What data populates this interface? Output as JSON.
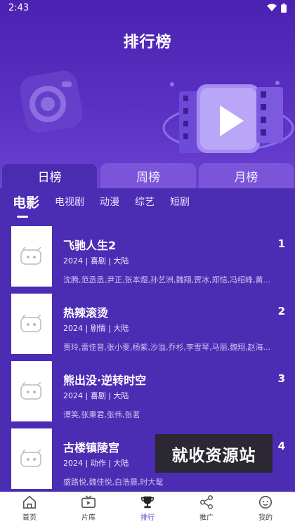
{
  "status": {
    "time": "2:43"
  },
  "page_title": "排行榜",
  "main_tabs": [
    {
      "label": "日榜",
      "active": true
    },
    {
      "label": "周榜",
      "active": false
    },
    {
      "label": "月榜",
      "active": false
    }
  ],
  "category_tabs": [
    {
      "label": "电影",
      "active": true
    },
    {
      "label": "电视剧",
      "active": false
    },
    {
      "label": "动漫",
      "active": false
    },
    {
      "label": "综艺",
      "active": false
    },
    {
      "label": "短剧",
      "active": false
    }
  ],
  "items": [
    {
      "title": "飞驰人生2",
      "meta": "2024 | 喜剧 | 大陆",
      "cast": "沈腾,范丞丞,尹正,张本煜,孙艺洲,魏翔,贾冰,郑恺,冯绍峰,黄...",
      "rank": "1"
    },
    {
      "title": "热辣滚烫",
      "meta": "2024 | 剧情 | 大陆",
      "cast": "贾玲,雷佳音,张小斐,杨紫,沙溢,乔杉,李雪琴,马丽,魏翔,赵海...",
      "rank": "2"
    },
    {
      "title": "熊出没·逆转时空",
      "meta": "2024 | 喜剧 | 大陆",
      "cast": "谭笑,张秉君,张伟,张茗",
      "rank": "3"
    },
    {
      "title": "古楼镇陵宫",
      "meta": "2024 | 动作 | 大陆",
      "cast": "盛路悦,魏佳悦,白浩晨,时大髦",
      "rank": "4"
    }
  ],
  "watermark": "就收资源站",
  "bottom_nav": [
    {
      "label": "首页",
      "icon": "home-icon",
      "active": false
    },
    {
      "label": "片库",
      "icon": "tv-icon",
      "active": false
    },
    {
      "label": "排行",
      "icon": "trophy-icon",
      "active": true
    },
    {
      "label": "推广",
      "icon": "share-icon",
      "active": false
    },
    {
      "label": "我的",
      "icon": "profile-icon",
      "active": false
    }
  ],
  "colors": {
    "primary": "#5a2fbf",
    "accent": "#6a3fd0",
    "tab_inactive": "#7a55d9"
  }
}
